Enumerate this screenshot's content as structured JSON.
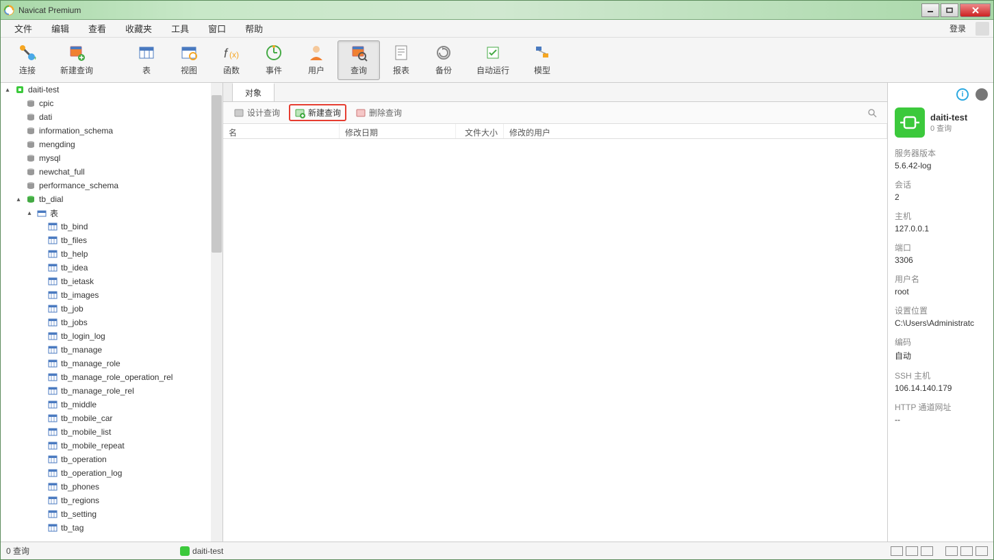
{
  "title": "Navicat Premium",
  "menubar": [
    "文件",
    "编辑",
    "查看",
    "收藏夹",
    "工具",
    "窗口",
    "帮助"
  ],
  "login_label": "登录",
  "toolbar": [
    {
      "label": "连接",
      "name": "connect"
    },
    {
      "label": "新建查询",
      "name": "new-query"
    },
    {
      "label": "表",
      "name": "table"
    },
    {
      "label": "视图",
      "name": "view"
    },
    {
      "label": "函数",
      "name": "function"
    },
    {
      "label": "事件",
      "name": "event"
    },
    {
      "label": "用户",
      "name": "user"
    },
    {
      "label": "查询",
      "name": "query",
      "active": true
    },
    {
      "label": "报表",
      "name": "report"
    },
    {
      "label": "备份",
      "name": "backup"
    },
    {
      "label": "自动运行",
      "name": "automation"
    },
    {
      "label": "模型",
      "name": "model"
    }
  ],
  "tree": {
    "connection": "daiti-test",
    "databases": [
      "cpic",
      "dati",
      "information_schema",
      "mengding",
      "mysql",
      "newchat_full",
      "performance_schema"
    ],
    "open_db": "tb_dial",
    "tables_label": "表",
    "tables": [
      "tb_bind",
      "tb_files",
      "tb_help",
      "tb_idea",
      "tb_ietask",
      "tb_images",
      "tb_job",
      "tb_jobs",
      "tb_login_log",
      "tb_manage",
      "tb_manage_role",
      "tb_manage_role_operation_rel",
      "tb_manage_role_rel",
      "tb_middle",
      "tb_mobile_car",
      "tb_mobile_list",
      "tb_mobile_repeat",
      "tb_operation",
      "tb_operation_log",
      "tb_phones",
      "tb_regions",
      "tb_setting",
      "tb_tag"
    ]
  },
  "tabs": {
    "object": "对象"
  },
  "actions": {
    "design": "设计查询",
    "new": "新建查询",
    "delete": "删除查询"
  },
  "columns": {
    "name": "名",
    "modified": "修改日期",
    "size": "文件大小",
    "user": "修改的用户"
  },
  "info": {
    "conn_name": "daiti-test",
    "conn_sub": "0 查询",
    "server_version_label": "服务器版本",
    "server_version": "5.6.42-log",
    "session_label": "会话",
    "session": "2",
    "host_label": "主机",
    "host": "127.0.0.1",
    "port_label": "端口",
    "port": "3306",
    "user_label": "用户名",
    "user": "root",
    "settings_label": "设置位置",
    "settings": "C:\\Users\\Administratc",
    "encoding_label": "编码",
    "encoding": "自动",
    "ssh_label": "SSH 主机",
    "ssh": "106.14.140.179",
    "http_label": "HTTP 通道网址",
    "http": "--"
  },
  "statusbar": {
    "left": "0 查询",
    "conn": "daiti-test"
  }
}
